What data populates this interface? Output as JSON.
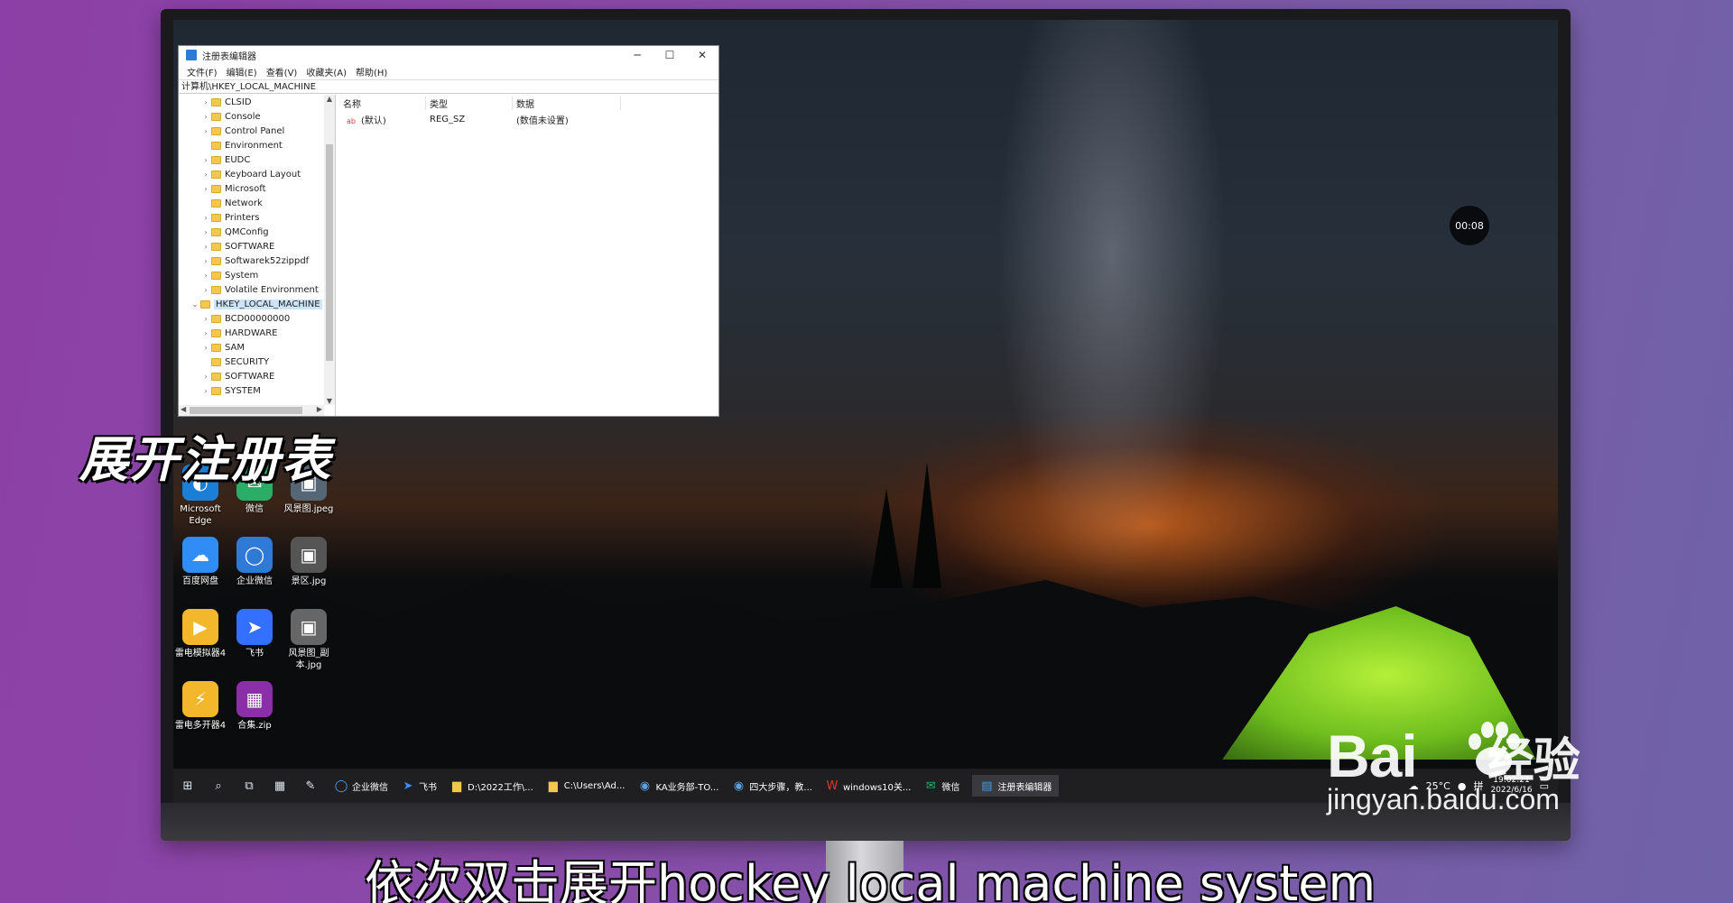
{
  "desktop": {
    "icons": [
      {
        "label": "Microsoft\nEdge",
        "icon": "edge-icon",
        "color": "#1a7fd6"
      },
      {
        "label": "微信",
        "icon": "wechat-icon",
        "color": "#2aae67"
      },
      {
        "label": "风景图.jpeg",
        "icon": "image-icon",
        "color": "#556677"
      },
      {
        "label": "百度网盘",
        "icon": "baidu-netdisk-icon",
        "color": "#2f8df5"
      },
      {
        "label": "企业微信",
        "icon": "wecom-icon",
        "color": "#2f7ad6"
      },
      {
        "label": "景区.jpg",
        "icon": "image-icon",
        "color": "#555555"
      },
      {
        "label": "雷电模拟器4",
        "icon": "ldplayer-icon",
        "color": "#f2b72a"
      },
      {
        "label": "飞书",
        "icon": "feishu-icon",
        "color": "#3370ff"
      },
      {
        "label": "风景图_副本.jpg",
        "icon": "image-icon",
        "color": "#666666"
      },
      {
        "label": "雷电多开器4",
        "icon": "ldmulti-icon",
        "color": "#f2b72a"
      },
      {
        "label": "合集.zip",
        "icon": "winrar-icon",
        "color": "#8b2fa8"
      }
    ]
  },
  "regedit": {
    "title": "注册表编辑器",
    "menu": [
      "文件(F)",
      "编辑(E)",
      "查看(V)",
      "收藏夹(A)",
      "帮助(H)"
    ],
    "address": "计算机\\HKEY_LOCAL_MACHINE",
    "tree": [
      {
        "label": "CLSID",
        "level": 2,
        "arrow": "›"
      },
      {
        "label": "Console",
        "level": 2,
        "arrow": "›"
      },
      {
        "label": "Control Panel",
        "level": 2,
        "arrow": "›"
      },
      {
        "label": "Environment",
        "level": 2,
        "arrow": ""
      },
      {
        "label": "EUDC",
        "level": 2,
        "arrow": "›"
      },
      {
        "label": "Keyboard Layout",
        "level": 2,
        "arrow": "›"
      },
      {
        "label": "Microsoft",
        "level": 2,
        "arrow": "›"
      },
      {
        "label": "Network",
        "level": 2,
        "arrow": ""
      },
      {
        "label": "Printers",
        "level": 2,
        "arrow": "›"
      },
      {
        "label": "QMConfig",
        "level": 2,
        "arrow": "›"
      },
      {
        "label": "SOFTWARE",
        "level": 2,
        "arrow": "›"
      },
      {
        "label": "Softwarek52zippdf",
        "level": 2,
        "arrow": "›"
      },
      {
        "label": "System",
        "level": 2,
        "arrow": "›"
      },
      {
        "label": "Volatile Environment",
        "level": 2,
        "arrow": "›"
      },
      {
        "label": "HKEY_LOCAL_MACHINE",
        "level": 1,
        "arrow": "⌄",
        "selected": true
      },
      {
        "label": "BCD00000000",
        "level": 2,
        "arrow": "›"
      },
      {
        "label": "HARDWARE",
        "level": 2,
        "arrow": "›"
      },
      {
        "label": "SAM",
        "level": 2,
        "arrow": "›"
      },
      {
        "label": "SECURITY",
        "level": 2,
        "arrow": ""
      },
      {
        "label": "SOFTWARE",
        "level": 2,
        "arrow": "›"
      },
      {
        "label": "SYSTEM",
        "level": 2,
        "arrow": "›"
      }
    ],
    "columns": [
      "名称",
      "类型",
      "数据"
    ],
    "values": [
      {
        "name": "(默认)",
        "type": "REG_SZ",
        "data": "(数值未设置)"
      }
    ]
  },
  "timer": "00:08",
  "taskbar": {
    "items": [
      {
        "label": "",
        "icon": "windows-start-icon"
      },
      {
        "label": "",
        "icon": "search-icon"
      },
      {
        "label": "",
        "icon": "task-view-icon"
      },
      {
        "label": "",
        "icon": "calculator-icon"
      },
      {
        "label": "",
        "icon": "notepad-icon"
      },
      {
        "label": "企业微信",
        "icon": "wecom-icon"
      },
      {
        "label": "飞书",
        "icon": "feishu-icon"
      },
      {
        "label": "D:\\2022工作\\...",
        "icon": "folder-icon"
      },
      {
        "label": "C:\\Users\\Ad...",
        "icon": "folder-icon"
      },
      {
        "label": "KA业务部-TO...",
        "icon": "sogou-browser-icon"
      },
      {
        "label": "四大步骤，教...",
        "icon": "sogou-browser-icon"
      },
      {
        "label": "windows10关...",
        "icon": "wps-icon"
      },
      {
        "label": "微信",
        "icon": "wechat-icon"
      },
      {
        "label": "注册表编辑器",
        "icon": "regedit-icon",
        "active": true
      }
    ],
    "weather": "25°C",
    "ime": "拼",
    "time": "19:02:21",
    "date": "2022/6/16"
  },
  "overlay": {
    "title": "展开注册表",
    "subtitle": "依次双击展开hockey local machine system"
  },
  "watermark": {
    "brand_prefix": "Bai",
    "brand_suffix": "经验",
    "url": "jingyan.baidu.com"
  }
}
